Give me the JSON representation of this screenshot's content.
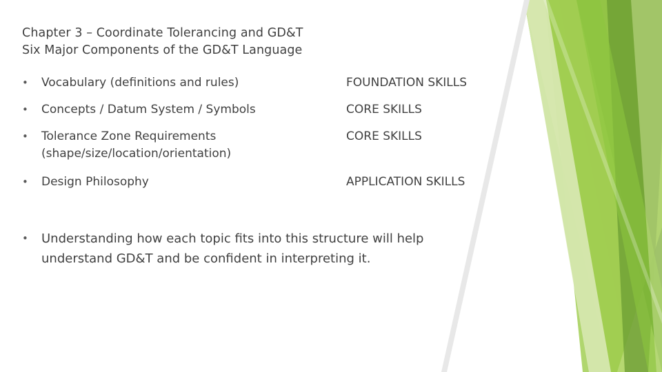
{
  "slide": {
    "title_line_1": "Chapter 3 – Coordinate Tolerancing and GD&T",
    "title_line_2": "Six Major Components of the GD&T Language",
    "bullet_char": "•",
    "items": [
      {
        "text": "Vocabulary (definitions and rules)",
        "sub": "",
        "right": "FOUNDATION SKILLS"
      },
      {
        "text": "Concepts / Datum System / Symbols",
        "sub": "",
        "right": "CORE SKILLS"
      },
      {
        "text": "Tolerance Zone Requirements",
        "sub": "(shape/size/location/orientation)",
        "right": "CORE SKILLS"
      },
      {
        "text": "Design Philosophy",
        "sub": "",
        "right": "APPLICATION SKILLS"
      }
    ],
    "summary": {
      "line_1": "Understanding how each topic fits into this structure will help",
      "line_2": "understand GD&T and be confident in interpreting it."
    }
  },
  "colors": {
    "text": "#404040",
    "bullet": "#595959",
    "green_dark": "#71a33a",
    "green_mid": "#8cc63e",
    "green_light": "#bddb7a",
    "green_pale": "#d9e9b5",
    "white": "#ffffff"
  }
}
